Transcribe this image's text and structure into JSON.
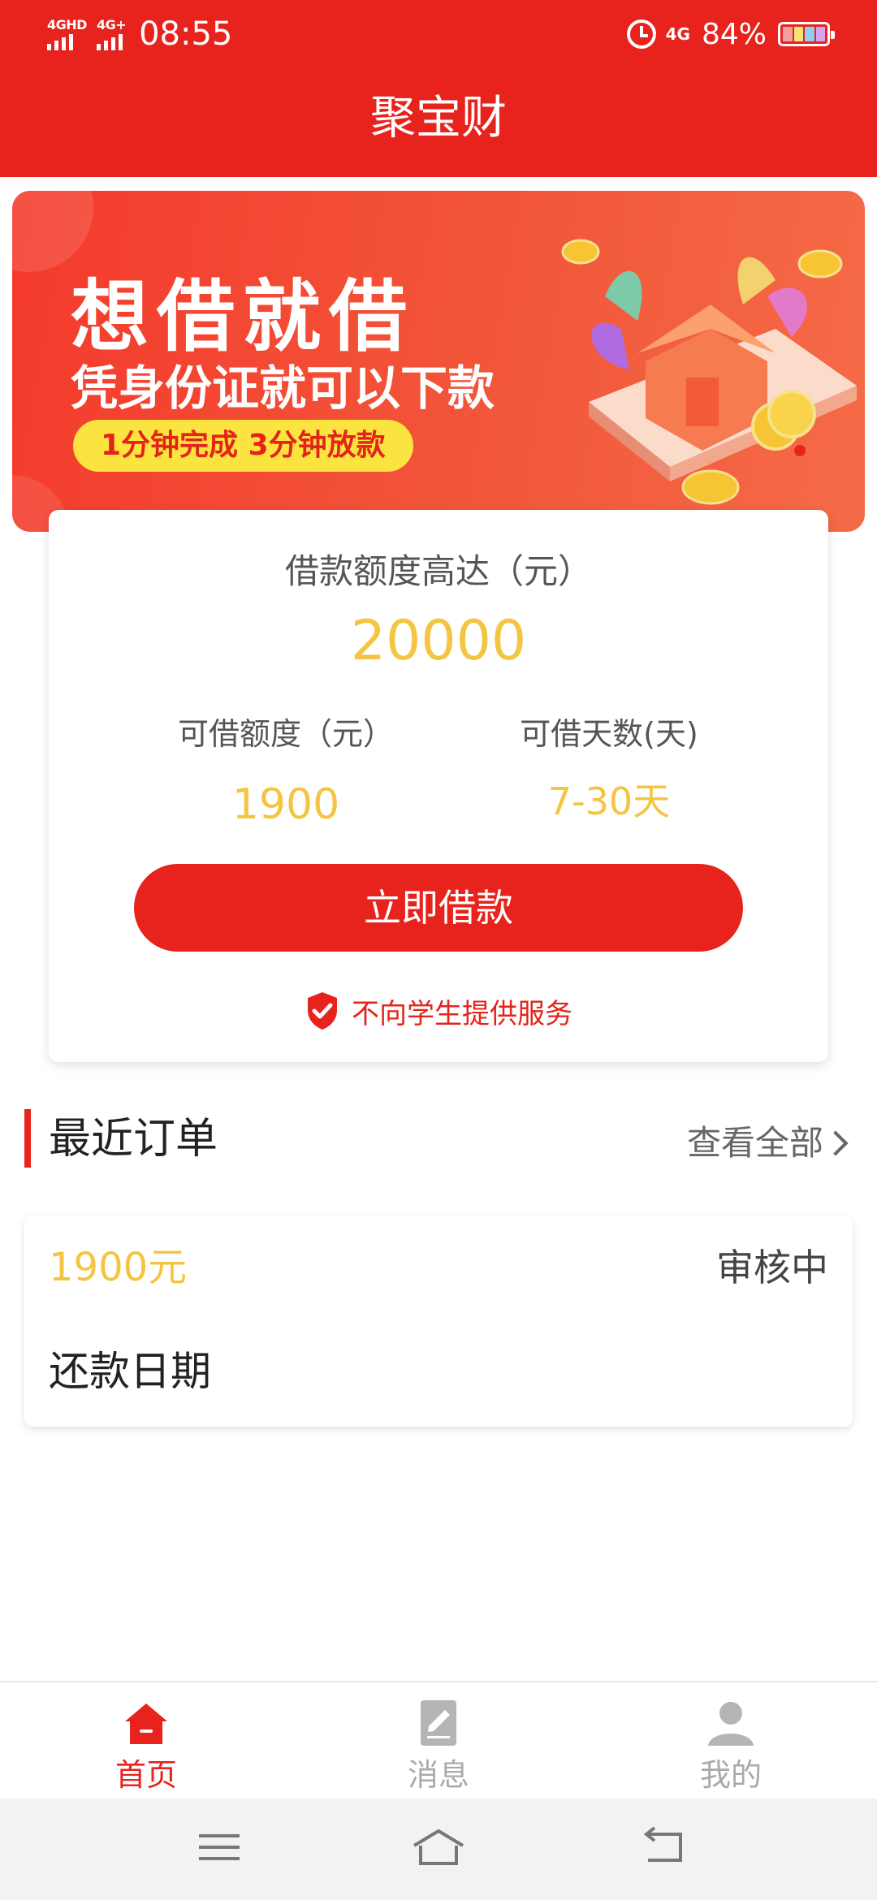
{
  "status_bar": {
    "signal1_label": "4GHD",
    "signal2_label": "4G+",
    "time": "08:55",
    "net_label": "4G",
    "battery_percent": "84%"
  },
  "header": {
    "title": "聚宝财"
  },
  "banner": {
    "headline": "想借就借",
    "subline": "凭身份证就可以下款",
    "pill": "1分钟完成 3分钟放款"
  },
  "loan_card": {
    "max_label": "借款额度高达（元）",
    "max_amount": "20000",
    "available_label": "可借额度（元）",
    "available_value": "1900",
    "days_label": "可借天数(天)",
    "days_value": "7-30天",
    "apply_button": "立即借款",
    "notice": "不向学生提供服务"
  },
  "recent_orders": {
    "title": "最近订单",
    "view_all": "查看全部",
    "items": [
      {
        "amount": "1900元",
        "status": "审核中",
        "repay_label": "还款日期"
      }
    ]
  },
  "tabbar": {
    "tabs": [
      {
        "label": "首页",
        "icon": "home-icon",
        "active": true
      },
      {
        "label": "消息",
        "icon": "message-icon",
        "active": false
      },
      {
        "label": "我的",
        "icon": "profile-icon",
        "active": false
      }
    ]
  },
  "colors": {
    "brand_red": "#E8221C",
    "amount_gold": "#F4C542",
    "pill_yellow": "#FBE43F",
    "battery_level": 0.84
  }
}
